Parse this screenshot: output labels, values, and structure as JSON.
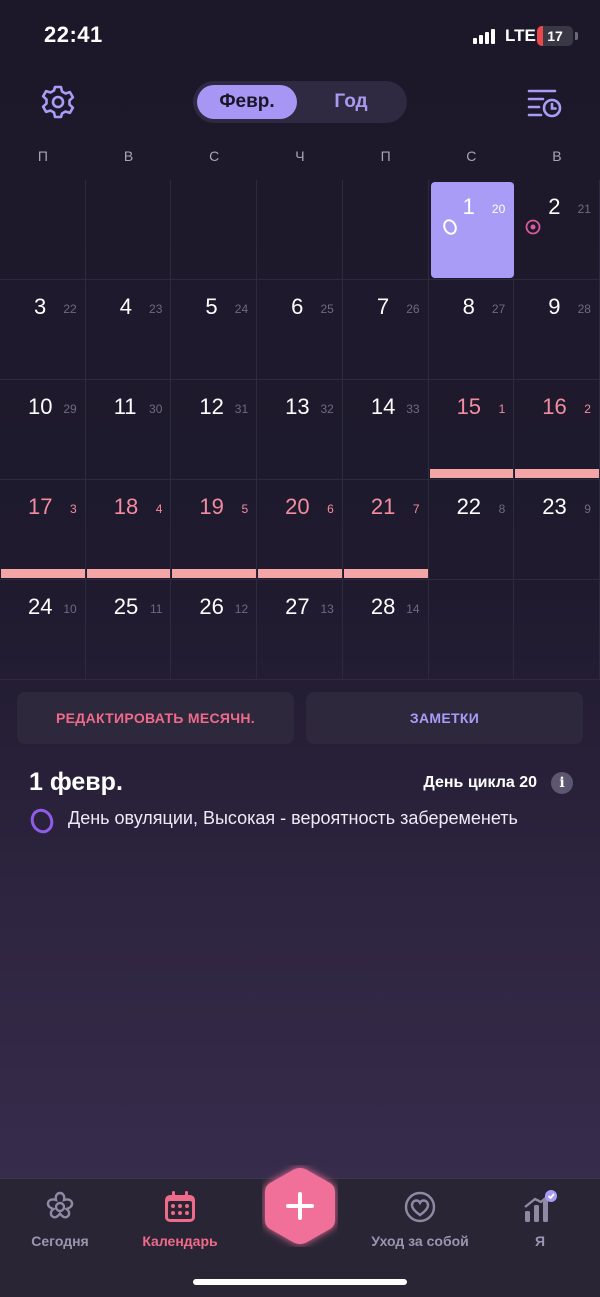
{
  "status_bar": {
    "time": "22:41",
    "network": "LTE",
    "battery": "17",
    "battery_level": 0.17
  },
  "header": {
    "segments": [
      "Февр.",
      "Год"
    ],
    "active_segment": "Февр."
  },
  "weekdays": [
    "П",
    "В",
    "С",
    "Ч",
    "П",
    "С",
    "В"
  ],
  "calendar": {
    "weeks": [
      [
        null,
        null,
        null,
        null,
        null,
        {
          "day": "1",
          "cycle": "20",
          "selected": true,
          "mark": "ovulation-icon"
        },
        {
          "day": "2",
          "cycle": "21",
          "mark": "target-icon"
        }
      ],
      [
        {
          "day": "3",
          "cycle": "22"
        },
        {
          "day": "4",
          "cycle": "23"
        },
        {
          "day": "5",
          "cycle": "24"
        },
        {
          "day": "6",
          "cycle": "25"
        },
        {
          "day": "7",
          "cycle": "26"
        },
        {
          "day": "8",
          "cycle": "27"
        },
        {
          "day": "9",
          "cycle": "28"
        }
      ],
      [
        {
          "day": "10",
          "cycle": "29"
        },
        {
          "day": "11",
          "cycle": "30"
        },
        {
          "day": "12",
          "cycle": "31"
        },
        {
          "day": "13",
          "cycle": "32"
        },
        {
          "day": "14",
          "cycle": "33"
        },
        {
          "day": "15",
          "cycle": "1",
          "period": true
        },
        {
          "day": "16",
          "cycle": "2",
          "period": true
        }
      ],
      [
        {
          "day": "17",
          "cycle": "3",
          "period": true
        },
        {
          "day": "18",
          "cycle": "4",
          "period": true
        },
        {
          "day": "19",
          "cycle": "5",
          "period": true
        },
        {
          "day": "20",
          "cycle": "6",
          "period": true
        },
        {
          "day": "21",
          "cycle": "7",
          "period": true
        },
        {
          "day": "22",
          "cycle": "8"
        },
        {
          "day": "23",
          "cycle": "9"
        }
      ],
      [
        {
          "day": "24",
          "cycle": "10"
        },
        {
          "day": "25",
          "cycle": "11"
        },
        {
          "day": "26",
          "cycle": "12"
        },
        {
          "day": "27",
          "cycle": "13"
        },
        {
          "day": "28",
          "cycle": "14"
        },
        null,
        null
      ]
    ]
  },
  "actions": {
    "edit_label": "РЕДАКТИРОВАТЬ МЕСЯЧН.",
    "notes_label": "ЗАМЕТКИ"
  },
  "selected_day": {
    "title": "1 февр.",
    "cycle_label": "День цикла 20",
    "info_glyph": "i",
    "event_text": "День овуляции, Высокая - вероятность забеременеть"
  },
  "tabs": [
    {
      "label": "Сегодня",
      "icon": "flower-icon",
      "active": false
    },
    {
      "label": "Календарь",
      "icon": "calendar-icon",
      "active": true
    },
    {
      "label": "Уход за собой",
      "icon": "heart-circle-icon",
      "active": false
    },
    {
      "label": "Я",
      "icon": "stats-icon",
      "active": false
    }
  ],
  "colors": {
    "accent": "#a99cf7",
    "period": "#f48ca0",
    "fab": "#f0709a"
  }
}
